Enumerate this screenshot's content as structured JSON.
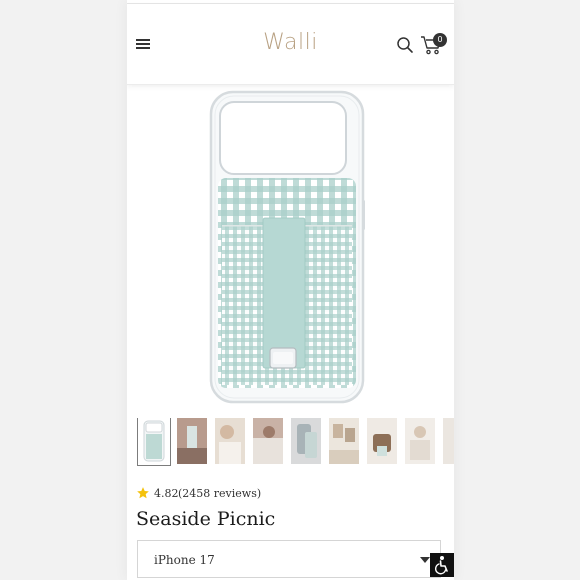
{
  "header": {
    "logo_text": "Walli",
    "cart_count": "0"
  },
  "icons": {
    "menu": "hamburger-menu-icon",
    "search": "search-icon",
    "cart": "cart-icon",
    "star": "star-icon",
    "dropdown": "chevron-down-icon",
    "accessibility": "accessibility-icon"
  },
  "colors": {
    "brand": "#b8a183",
    "star": "#f4c20d",
    "gingham": "#a9cfc9",
    "case_clear": "#e4e8ea"
  },
  "gallery": {
    "thumbnail_count": 9,
    "selected_index": 0
  },
  "product": {
    "rating": "4.82",
    "reviews": "(2458 reviews)",
    "title": "Seaside Picnic",
    "variant_selected": "iPhone 17"
  }
}
